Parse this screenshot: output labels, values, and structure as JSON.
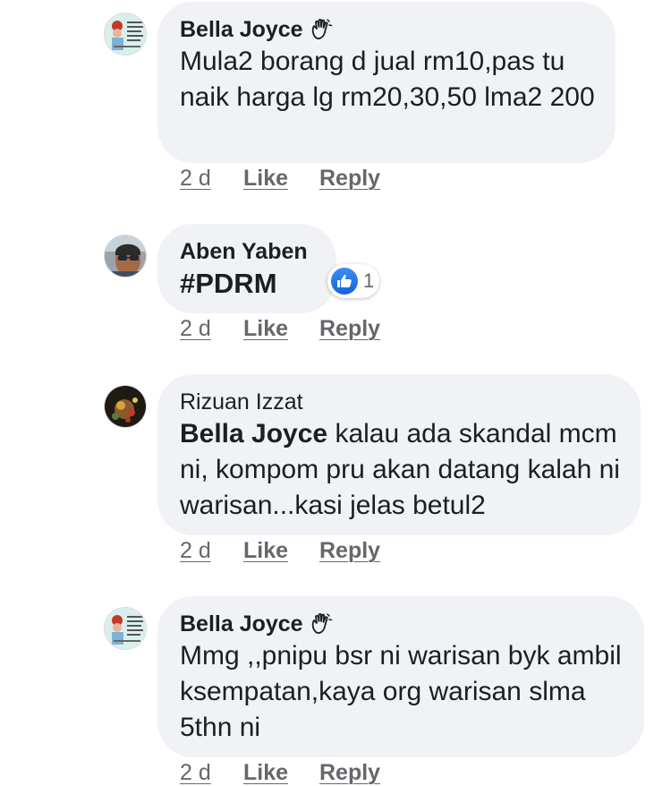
{
  "comments": [
    {
      "author": "Bella Joyce",
      "text": "Mula2 borang d jual rm10,pas tu naik harga lg rm20,30,50 lma2 200",
      "time": "2 d",
      "like_label": "Like",
      "reply_label": "Reply",
      "badge_icon": "wave-hand-icon"
    },
    {
      "author": "Aben Yaben",
      "text": "#PDRM",
      "time": "2 d",
      "like_label": "Like",
      "reply_label": "Reply",
      "reaction_count": "1",
      "reaction_icon": "thumbs-up-icon"
    },
    {
      "author": "Rizuan Izzat",
      "mention": "Bella Joyce",
      "text": " kalau ada skandal mcm ni, kompom pru akan datang kalah ni warisan...kasi jelas betul2",
      "time": "2 d",
      "like_label": "Like",
      "reply_label": "Reply"
    },
    {
      "author": "Bella Joyce",
      "text": "Mmg ,,pnipu bsr ni warisan byk ambil ksempatan,kaya org warisan slma 5thn ni",
      "time": "2 d",
      "like_label": "Like",
      "reply_label": "Reply",
      "badge_icon": "wave-hand-icon"
    }
  ],
  "colors": {
    "bubble": "#f0f2f5",
    "text": "#1c1e21",
    "meta": "#65676b",
    "like_blue": "#1877f2"
  }
}
